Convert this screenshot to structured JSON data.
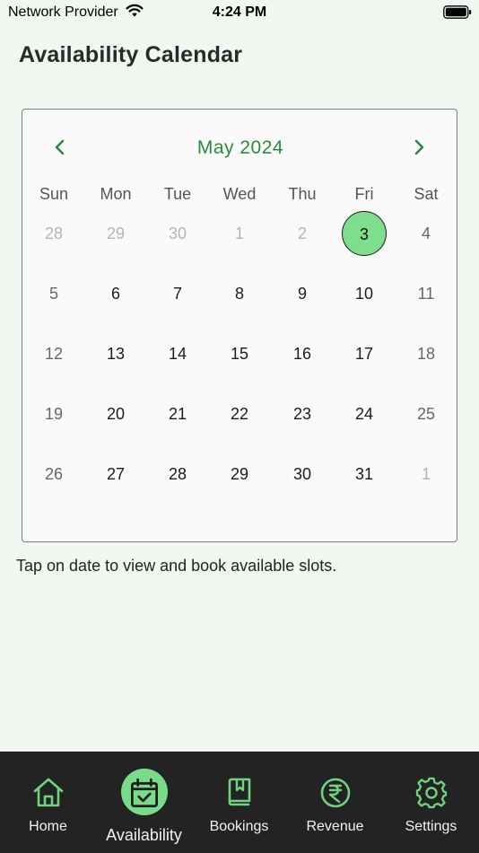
{
  "status_bar": {
    "carrier": "Network Provider",
    "time": "4:24 PM"
  },
  "header": {
    "title": "Availability Calendar"
  },
  "calendar": {
    "month_label": "May 2024",
    "weekdays": [
      "Sun",
      "Mon",
      "Tue",
      "Wed",
      "Thu",
      "Fri",
      "Sat"
    ],
    "selected_day": "3",
    "weeks": [
      [
        "28",
        "29",
        "30",
        "1",
        "2",
        "3",
        "4"
      ],
      [
        "5",
        "6",
        "7",
        "8",
        "9",
        "10",
        "11"
      ],
      [
        "12",
        "13",
        "14",
        "15",
        "16",
        "17",
        "18"
      ],
      [
        "19",
        "20",
        "21",
        "22",
        "23",
        "24",
        "25"
      ],
      [
        "26",
        "27",
        "28",
        "29",
        "30",
        "31",
        "1"
      ]
    ]
  },
  "hint": "Tap on date to view and book available slots.",
  "tabs": [
    {
      "label": "Home",
      "icon": "home-icon",
      "active": false
    },
    {
      "label": "Availability",
      "icon": "calendar-check-icon",
      "active": true
    },
    {
      "label": "Bookings",
      "icon": "book-icon",
      "active": false
    },
    {
      "label": "Revenue",
      "icon": "rupee-icon",
      "active": false
    },
    {
      "label": "Settings",
      "icon": "gear-icon",
      "active": false
    }
  ],
  "colors": {
    "accent": "#2a8a3e",
    "icon_green": "#6fd382",
    "selected_fill": "#7ddf8d",
    "tabbar_bg": "#232323",
    "page_bg": "#f1f8f2"
  }
}
